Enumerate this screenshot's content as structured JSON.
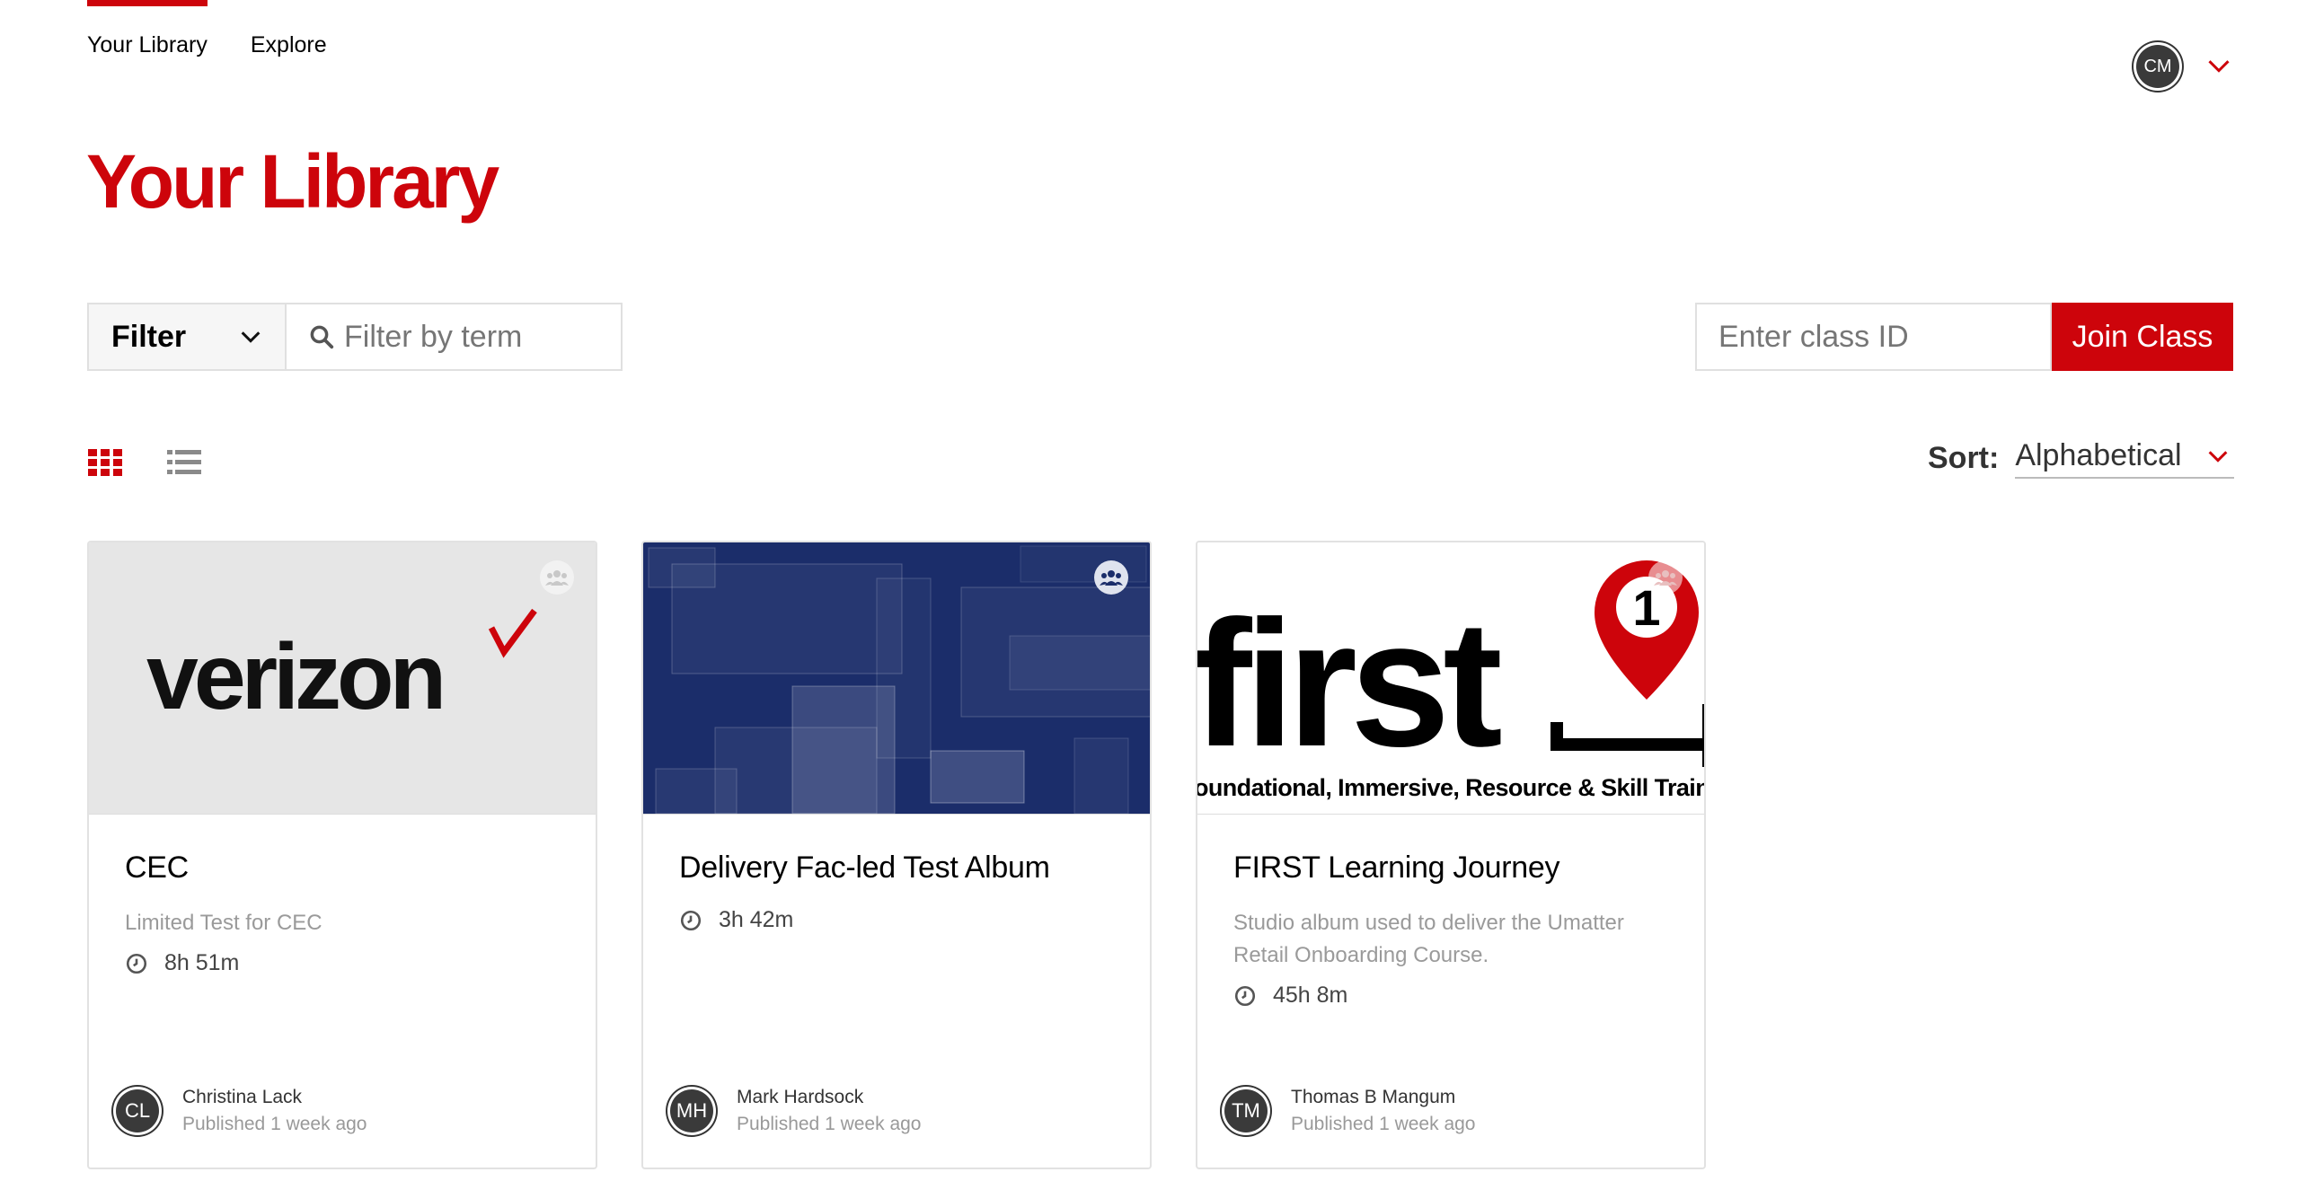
{
  "nav": {
    "library": "Your Library",
    "explore": "Explore"
  },
  "user": {
    "initials": "CM"
  },
  "page": {
    "title": "Your Library"
  },
  "filter": {
    "label": "Filter",
    "placeholder": "Filter by term"
  },
  "join": {
    "placeholder": "Enter class ID",
    "button": "Join Class"
  },
  "sort": {
    "label": "Sort:",
    "value": "Alphabetical"
  },
  "colors": {
    "accent": "#cd040b",
    "navy": "#1b2d6a"
  },
  "cards": [
    {
      "title": "CEC",
      "description": "Limited Test for CEC",
      "duration": "8h 51m",
      "author_initials": "CL",
      "author": "Christina Lack",
      "published": "Published 1 week ago",
      "logo_text": "verizon"
    },
    {
      "title": "Delivery Fac-led Test Album",
      "description": "",
      "duration": "3h 42m",
      "author_initials": "MH",
      "author": "Mark Hardsock",
      "published": "Published 1 week ago"
    },
    {
      "title": "FIRST Learning Journey",
      "description": "Studio album used to deliver the Umatter Retail Onboarding Course.",
      "duration": "45h 8m",
      "author_initials": "TM",
      "author": "Thomas B Mangum",
      "published": "Published 1 week ago",
      "logo_text": "first",
      "logo_pin": "1",
      "logo_tagline": "oundational, Immersive, Resource & Skill Traini"
    }
  ]
}
